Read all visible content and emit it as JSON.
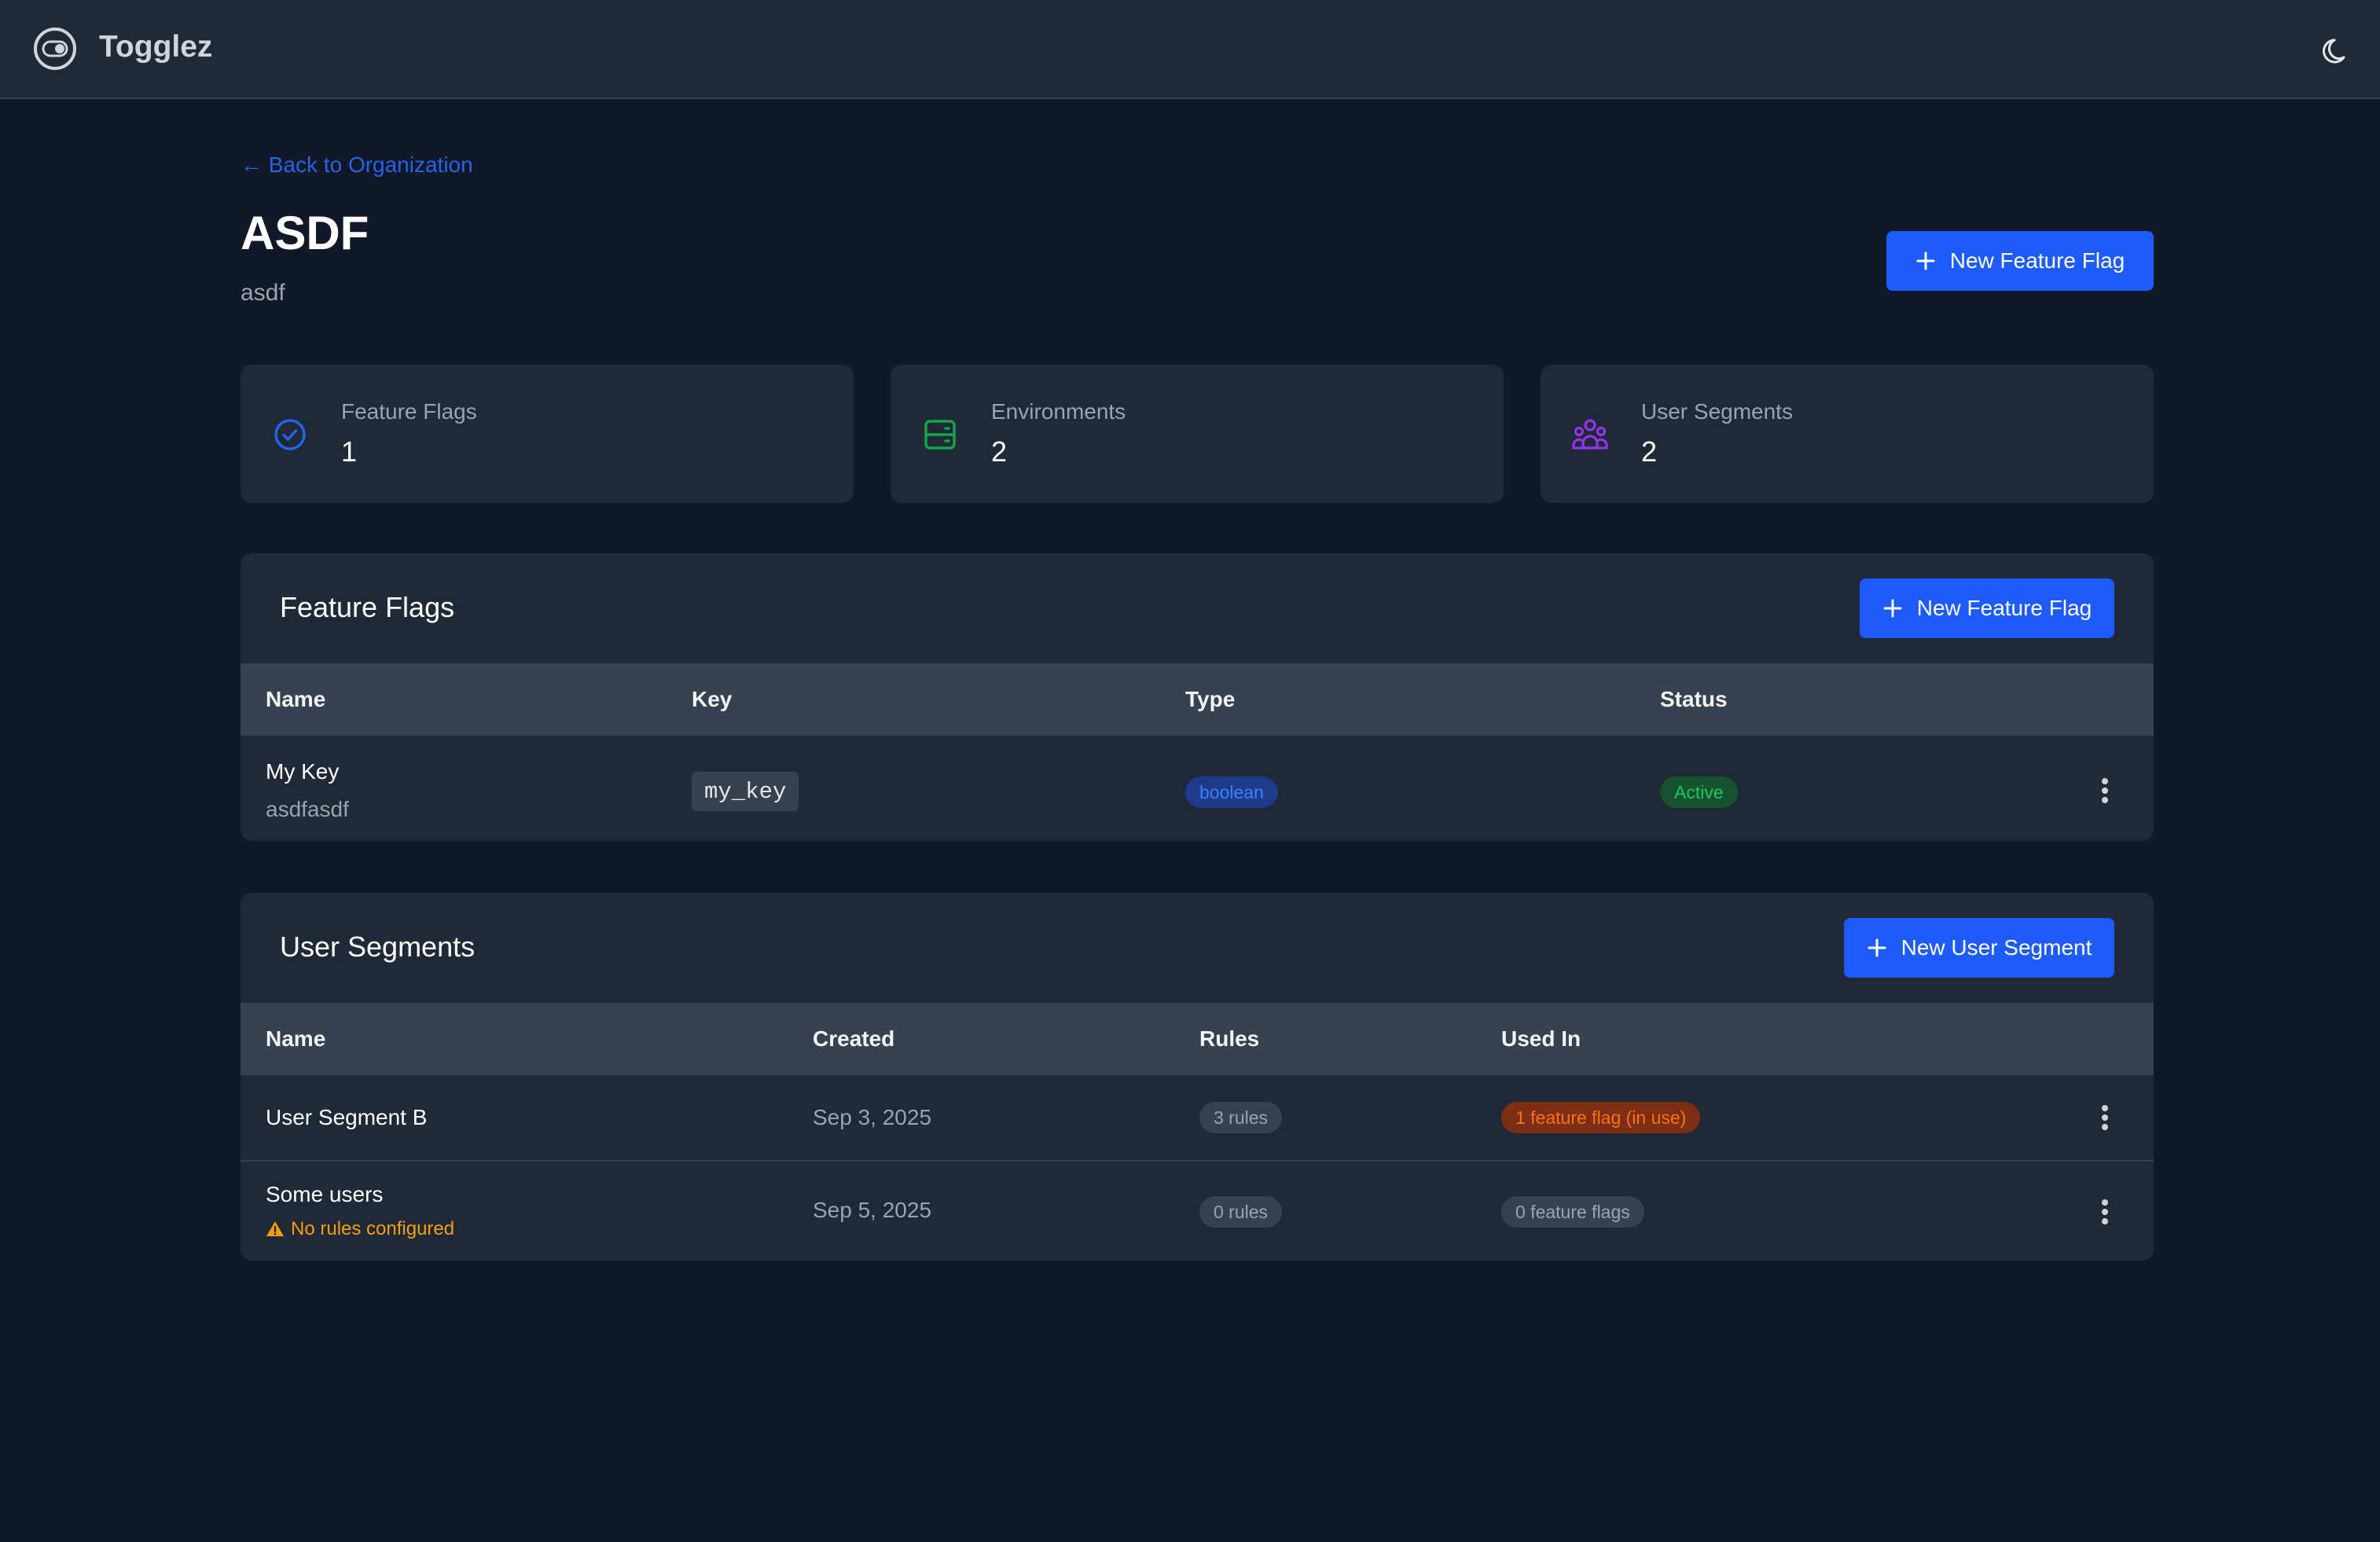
{
  "app": {
    "title": "Togglez"
  },
  "header": {
    "back_label": "← Back to Organization",
    "project_name": "ASDF",
    "project_key": "asdf",
    "new_flag_label": "New Feature Flag"
  },
  "stats": [
    {
      "label": "Feature Flags",
      "value": "1",
      "icon": "check-circle-icon",
      "color": "#2563eb"
    },
    {
      "label": "Environments",
      "value": "2",
      "icon": "server-icon",
      "color": "#16a34a"
    },
    {
      "label": "User Segments",
      "value": "2",
      "icon": "user-group-icon",
      "color": "#9333ea"
    }
  ],
  "flags_panel": {
    "title": "Feature Flags",
    "new_label": "New Feature Flag",
    "columns": [
      "Name",
      "Key",
      "Type",
      "Status"
    ],
    "rows": [
      {
        "name": "My Key",
        "description": "asdfasdf",
        "key": "my_key",
        "type": "boolean",
        "status": "Active"
      }
    ]
  },
  "segments_panel": {
    "title": "User Segments",
    "new_label": "New User Segment",
    "columns": [
      "Name",
      "Created",
      "Rules",
      "Used In"
    ],
    "rows": [
      {
        "name": "User Segment B",
        "warning": "",
        "created": "Sep 3, 2025",
        "rules": "3 rules",
        "used_in": "1 feature flag (in use)"
      },
      {
        "name": "Some users",
        "warning": "No rules configured",
        "created": "Sep 5, 2025",
        "rules": "0 rules",
        "used_in": "0 feature flags"
      }
    ]
  },
  "colors": {
    "accent": "#1d5cfb",
    "background": "#111827",
    "surface": "#1f2937",
    "warning": "#f59e0b"
  }
}
